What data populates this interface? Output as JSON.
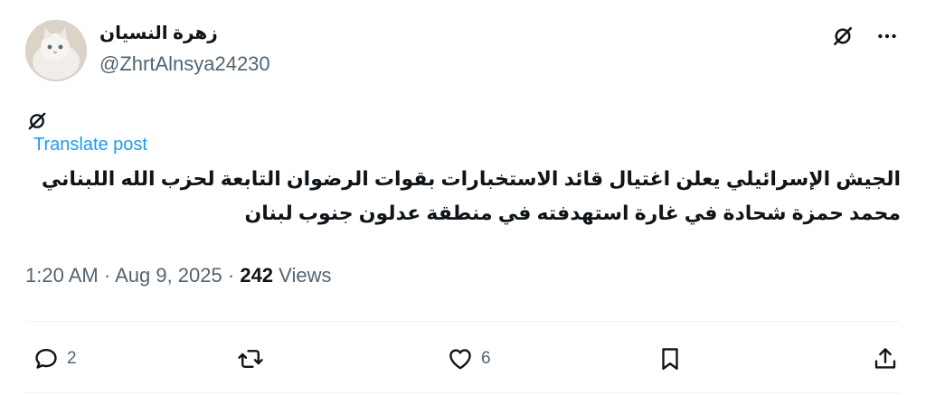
{
  "author": {
    "display_name": "زهرة النسيان",
    "handle": "@ZhrtAlnsya24230"
  },
  "translate_label": "Translate post",
  "tweet_text": "الجيش الإسرائيلي يعلن اغتيال قائد الاستخبارات بقوات الرضوان التابعة لحزب الله اللبناني محمد حمزة شحادة في غارة استهدفته في منطقة عدلون جنوب لبنان",
  "meta": {
    "time": "1:20 AM",
    "date": "Aug 9, 2025",
    "views_count": "242",
    "views_label": "Views"
  },
  "actions": {
    "reply_count": "2",
    "like_count": "6"
  },
  "icons": {
    "top": [
      "no-edit-icon",
      "more-icon"
    ],
    "body": "no-edit-icon",
    "bar": [
      "reply-icon",
      "repost-icon",
      "like-icon",
      "bookmark-icon",
      "share-icon"
    ]
  },
  "colors": {
    "link": "#1d9bf0",
    "secondary_text": "#536471",
    "primary_text": "#0f1419"
  }
}
